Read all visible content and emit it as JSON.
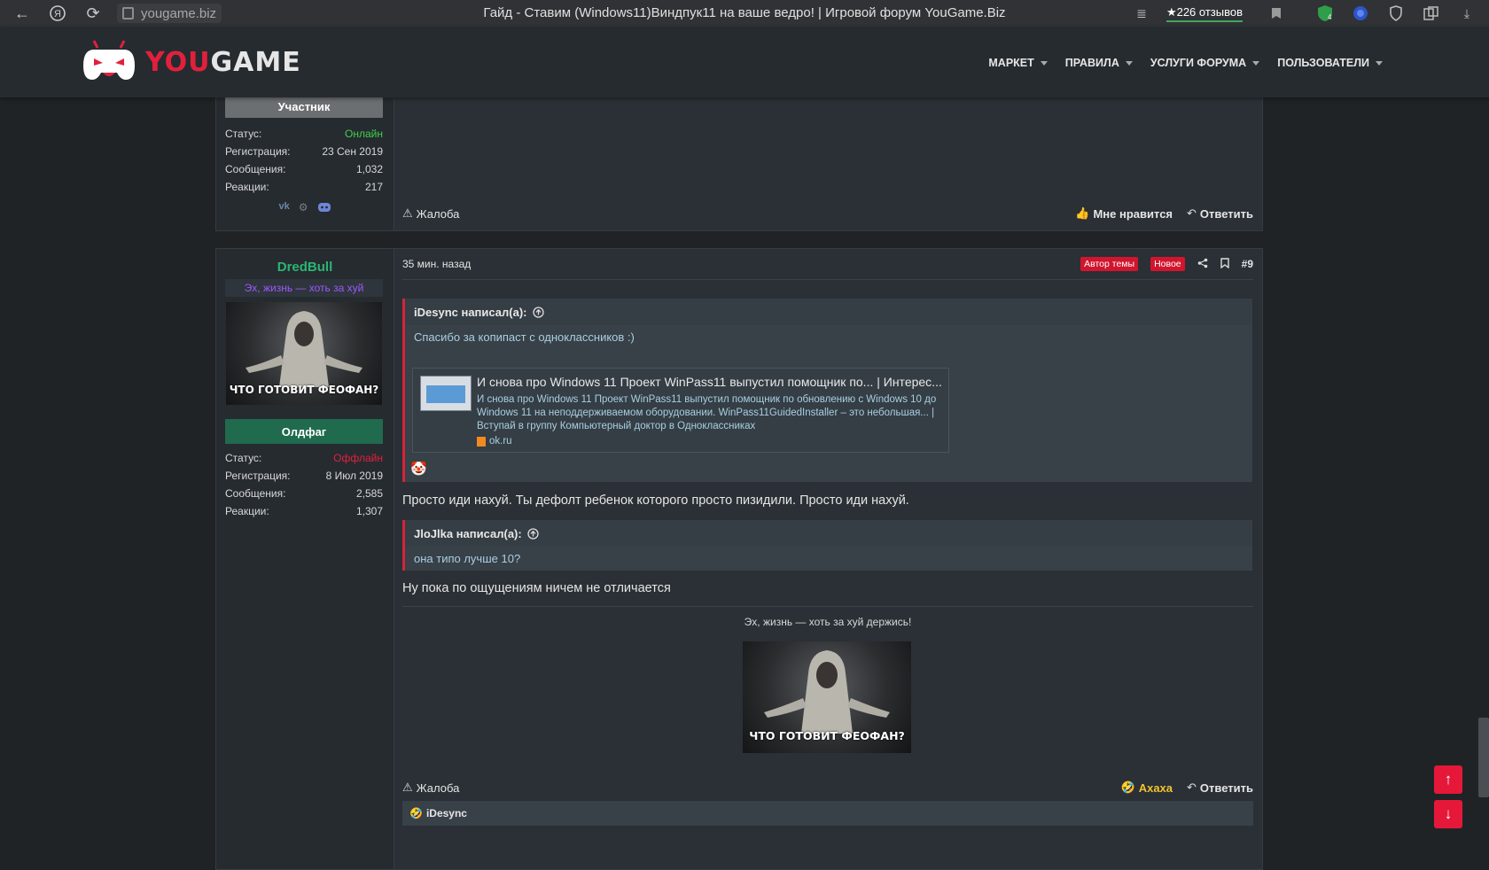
{
  "browser": {
    "url": "yougame.biz",
    "tab_title": "Гайд - Ставим (Windows11)Виндпук11 на ваше ведро! | Игровой форум YouGame.Biz",
    "reviews": "★226 отзывов"
  },
  "site": {
    "logo_text_you": "YOU",
    "logo_text_game": "GAME",
    "nav": [
      "МАРКЕТ",
      "ПРАВИЛА",
      "УСЛУГИ ФОРУМА",
      "ПОЛЬЗОВАТЕЛИ"
    ]
  },
  "post1": {
    "rank": "Участник",
    "stats": [
      {
        "label": "Статус:",
        "value": "Онлайн"
      },
      {
        "label": "Регистрация:",
        "value": "23 Сен 2019"
      },
      {
        "label": "Сообщения:",
        "value": "1,032"
      },
      {
        "label": "Реакции:",
        "value": "217"
      }
    ],
    "report": "Жалоба",
    "like": "Мне нравится",
    "reply": "Ответить"
  },
  "post2": {
    "username": "DredBull",
    "user_title": "Эх, жизнь — хоть за хуй",
    "avatar_caption": "ЧТО ГОТОВИТ ФЕОФАН?",
    "rank": "Олдфаг",
    "stats": [
      {
        "label": "Статус:",
        "value": "Оффлайн"
      },
      {
        "label": "Регистрация:",
        "value": "8 Июл 2019"
      },
      {
        "label": "Сообщения:",
        "value": "2,585"
      },
      {
        "label": "Реакции:",
        "value": "1,307"
      }
    ],
    "time": "35 мин. назад",
    "badge_author": "Автор темы",
    "badge_new": "Новое",
    "post_number": "#9",
    "quote1": {
      "author": "iDesync написал(а):",
      "text": "Спасибо за копипаст с одноклассников :)",
      "link_title": "И снова про Windows 11 Проект WinPass11 выпустил помощник по... | Интерес...",
      "link_desc": "И снова про Windows 11 Проект WinPass11 выпустил помощник по обновлению с Windows 10 до Windows 11 на неподдерживаемом оборудовании. WinPass11GuidedInstaller – это небольшая... | Вступай в группу Компьютерный доктор в Одноклассниках",
      "link_domain": "ok.ru"
    },
    "text1": "Просто иди нахуй. Ты дефолт ребенок которого просто пизидили. Просто иди нахуй.",
    "quote2": {
      "author": "JloJlka написал(а):",
      "text": "она типо лучше 10?"
    },
    "text2": "Ну пока по ощущениям ничем не отличается",
    "signature": "Эх, жизнь — хоть за хуй держись!",
    "signature_caption": "ЧТО ГОТОВИТ ФЕОФАН?",
    "report": "Жалоба",
    "reaction": "Ахаха",
    "reply": "Ответить",
    "reacted_user": "iDesync"
  },
  "colors": {
    "accent": "#e2203c",
    "online": "#3fd14a",
    "offline": "#e2203c",
    "username": "#2bb673",
    "user_title": "#9b59ff"
  }
}
